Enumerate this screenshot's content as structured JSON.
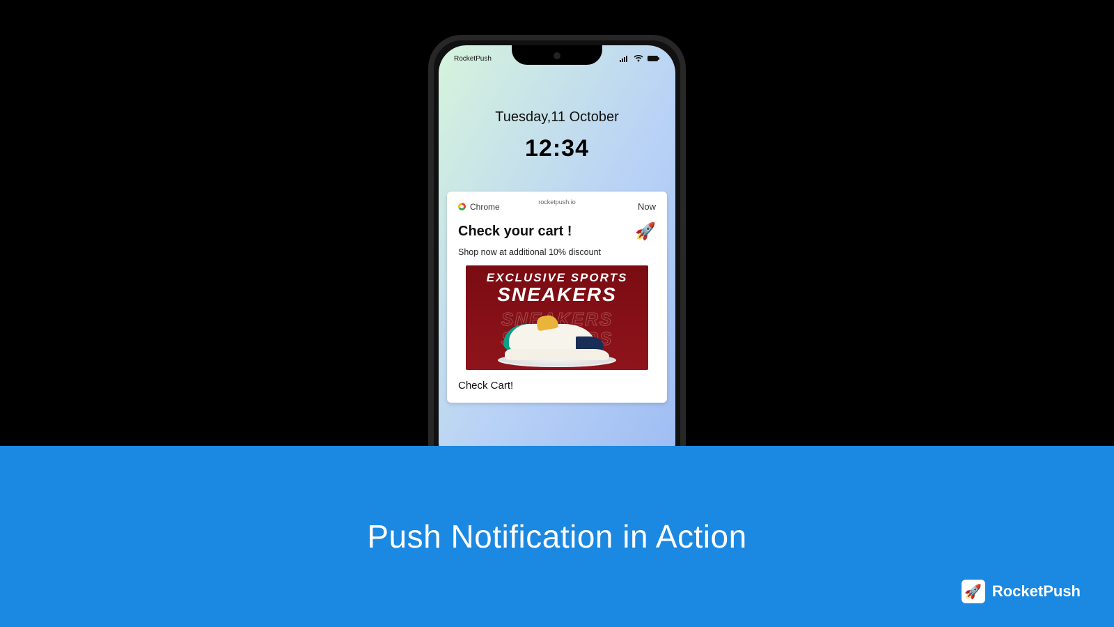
{
  "banner": {
    "title": "Push Notification in Action",
    "brand_name": "RocketPush",
    "brand_icon": "🚀"
  },
  "phone": {
    "status_app": "RocketPush",
    "lock_date": "Tuesday,11 October",
    "lock_time": "12:34"
  },
  "notification": {
    "app_label": "Chrome",
    "domain": "rocketpush.io",
    "time_label": "Now",
    "title": "Check your cart !",
    "body": "Shop now at additional 10% discount",
    "icon": "🚀",
    "promo_line1": "EXCLUSIVE SPORTS",
    "promo_line2": "SNEAKERS",
    "promo_ghost": "SNEAKERS",
    "cta": "Check Cart!"
  }
}
